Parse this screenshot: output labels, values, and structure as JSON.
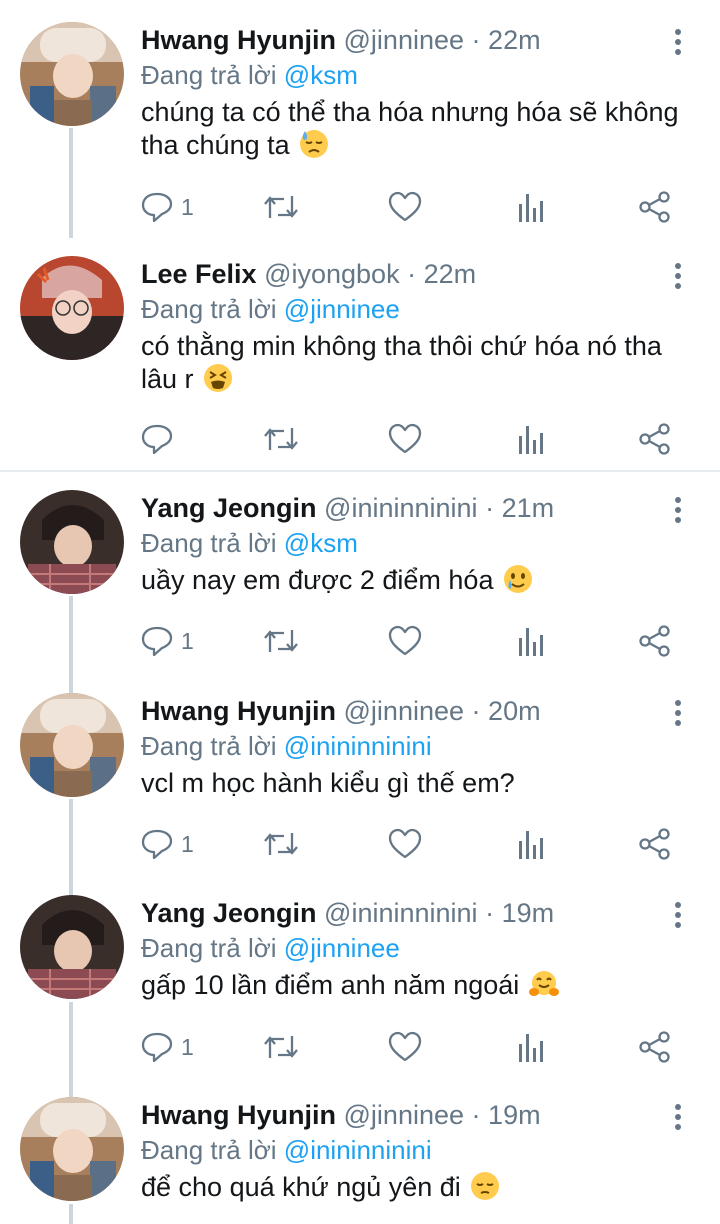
{
  "tweets": [
    {
      "name": "Hwang Hyunjin",
      "handle": "@jinninee",
      "time": "22m",
      "replying_label": "Đang trả lời",
      "replying_to": "@ksm",
      "text": "chúng ta có thể tha hóa nhưng hóa sẽ không tha chúng ta",
      "emoji": "downcast-sweat-face",
      "reply_count": "1"
    },
    {
      "name": "Lee Felix",
      "handle": "@iyongbok",
      "time": "22m",
      "replying_label": "Đang trả lời",
      "replying_to": "@jinninee",
      "text": "có thằng min không tha thôi chứ hóa nó tha lâu r",
      "emoji": "tired-face",
      "reply_count": ""
    },
    {
      "name": "Yang Jeongin",
      "handle": "@inininninini",
      "time": "21m",
      "replying_label": "Đang trả lời",
      "replying_to": "@ksm",
      "text": "uầy nay em được 2 điểm hóa",
      "emoji": "smiling-tear-face",
      "reply_count": "1"
    },
    {
      "name": "Hwang Hyunjin",
      "handle": "@jinninee",
      "time": "20m",
      "replying_label": "Đang trả lời",
      "replying_to": "@inininninini",
      "text": "vcl m học hành kiểu gì thế em?",
      "emoji": "",
      "reply_count": "1"
    },
    {
      "name": "Yang Jeongin",
      "handle": "@inininninini",
      "time": "19m",
      "replying_label": "Đang trả lời",
      "replying_to": "@jinninee",
      "text": "gấp 10 lần điểm anh năm ngoái",
      "emoji": "hugging-face",
      "reply_count": "1"
    },
    {
      "name": "Hwang Hyunjin",
      "handle": "@jinninee",
      "time": "19m",
      "replying_label": "Đang trả lời",
      "replying_to": "@inininninini",
      "text": "để cho quá khứ ngủ yên đi",
      "emoji": "pensive-face",
      "reply_count": ""
    }
  ],
  "separator": "·",
  "colors": {
    "name": "#14171a",
    "meta": "#657786",
    "link": "#1da1f2",
    "icon": "#657786",
    "thread_line": "#ccd6dd",
    "divider": "#e6ecf0",
    "emoji_yellow": "#ffcc4d"
  },
  "icons": [
    "reply-icon",
    "retweet-icon",
    "like-icon",
    "analytics-icon",
    "share-icon",
    "more-options-icon"
  ]
}
